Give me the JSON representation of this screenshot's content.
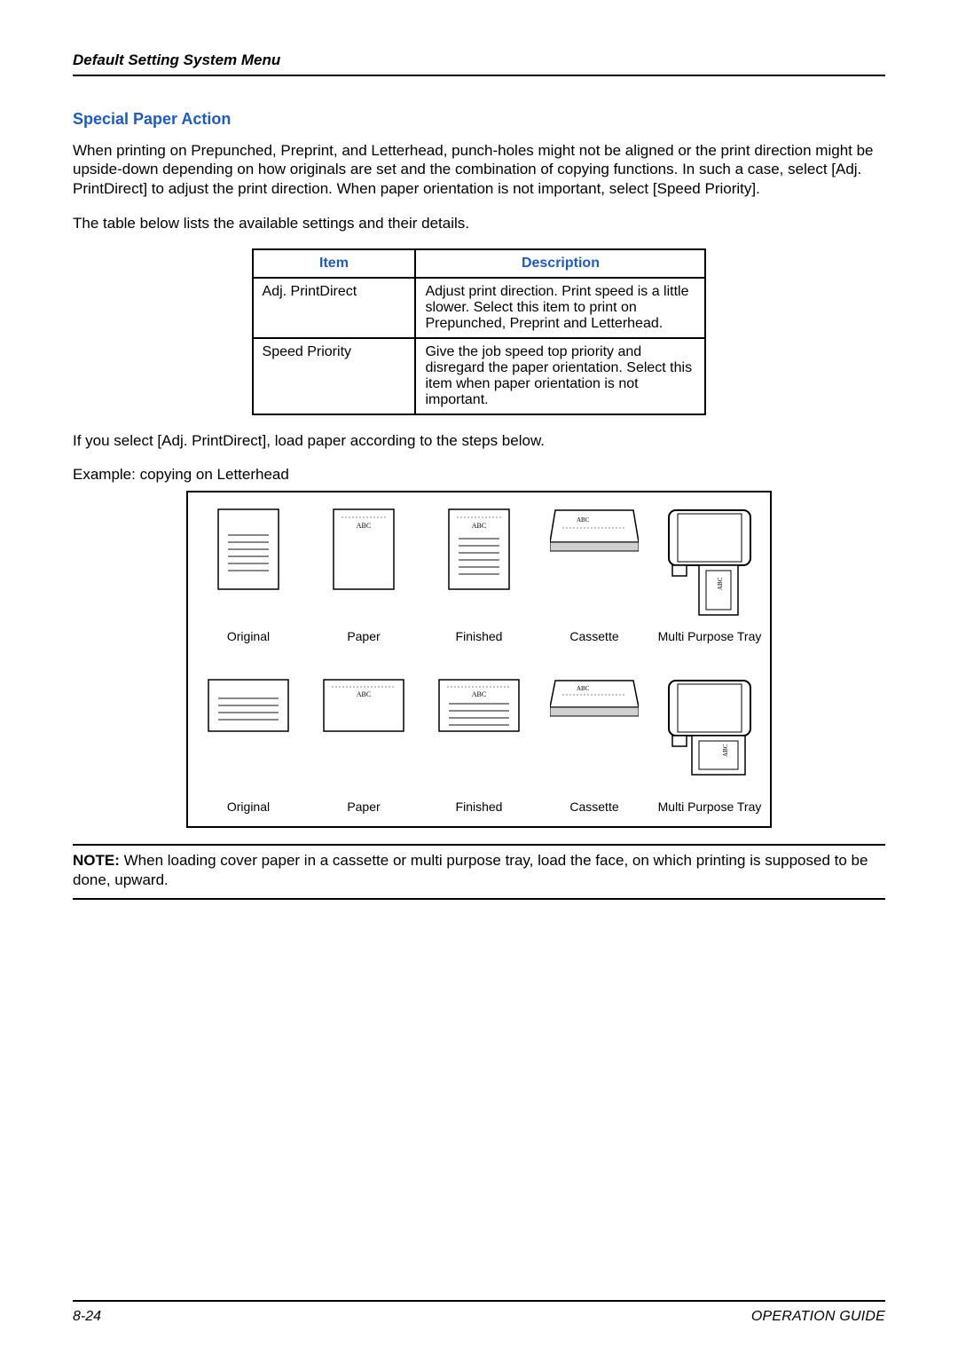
{
  "header": {
    "breadcrumb": "Default Setting System Menu"
  },
  "section": {
    "title": "Special Paper Action",
    "intro": "When printing on Prepunched, Preprint, and Letterhead, punch-holes might not be aligned or the print direction might be upside-down depending on how originals are set and the combination of copying functions. In such a case, select [Adj. PrintDirect] to adjust the print direction. When paper orientation is not important, select [Speed Priority].",
    "table_intro": "The table below lists the available settings and their details.",
    "table": {
      "head": {
        "item": "Item",
        "desc": "Description"
      },
      "rows": [
        {
          "item": "Adj. PrintDirect",
          "desc": "Adjust print direction. Print speed is a little slower. Select this item to print on Prepunched, Preprint and Letterhead."
        },
        {
          "item": "Speed Priority",
          "desc": "Give the job speed top priority and disregard the paper orientation. Select this item when paper orientation is not important."
        }
      ]
    },
    "after_table": "If you select [Adj. PrintDirect], load paper according to the steps below.",
    "example_caption": "Example: copying on Letterhead",
    "diagram_labels": {
      "original": "Original",
      "paper": "Paper",
      "finished": "Finished",
      "cassette": "Cassette",
      "mptray": "Multi Purpose Tray",
      "abc": "ABC"
    },
    "note": {
      "label": "NOTE:",
      "text": " When loading cover paper in a cassette or multi purpose tray, load the face, on which printing is supposed to be done, upward."
    }
  },
  "footer": {
    "page": "8-24",
    "guide": "OPERATION GUIDE"
  }
}
